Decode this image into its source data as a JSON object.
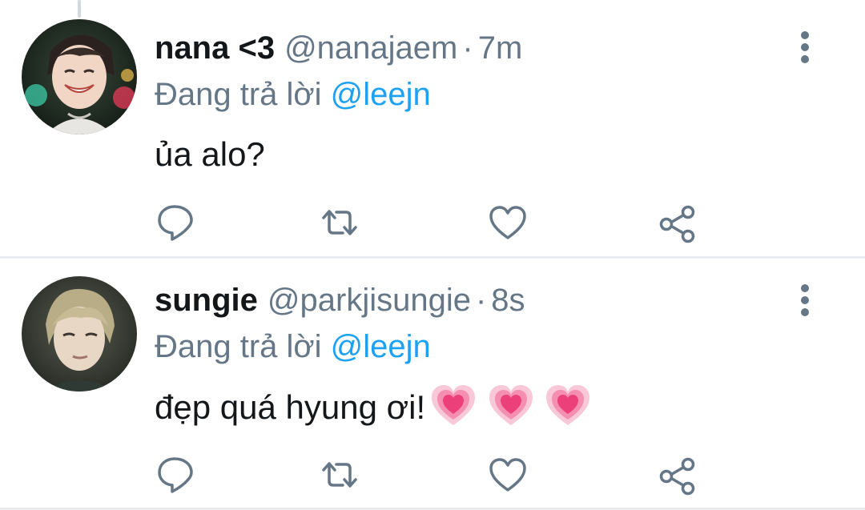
{
  "tweets": [
    {
      "display_name": "nana <3",
      "handle": "@nanajaem",
      "separator": "·",
      "time": "7m",
      "reply_prefix": "Đang trả lời",
      "reply_to": "@leejn",
      "text": "ủa alo?",
      "emoji": []
    },
    {
      "display_name": "sungie",
      "handle": "@parkjisungie",
      "separator": "·",
      "time": "8s",
      "reply_prefix": "Đang trả lời",
      "reply_to": "@leejn",
      "text": "đẹp quá hyung ơi!",
      "emoji": [
        "growing-heart",
        "growing-heart",
        "growing-heart"
      ]
    }
  ],
  "icons": {
    "reply": "reply-icon",
    "retweet": "retweet-icon",
    "like": "like-icon",
    "share": "share-icon",
    "more": "more-options-icon"
  },
  "colors": {
    "text": "#14171a",
    "secondary": "#657786",
    "link": "#1da1f2",
    "divider": "#e6ecf0",
    "heart_emoji": "#f06292"
  }
}
